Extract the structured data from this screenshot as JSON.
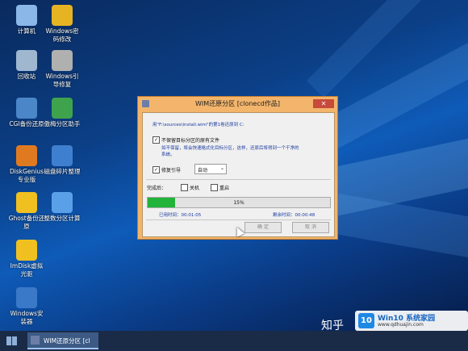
{
  "desktop_icons": [
    {
      "label": "计算机",
      "icon": "computer-icon",
      "color": "#8ab6e8"
    },
    {
      "label": "Windows密\n码修改",
      "icon": "key-icon",
      "color": "#e6b422"
    },
    {
      "label": "回收站",
      "icon": "recycle-bin-icon",
      "color": "#9fb7cf"
    },
    {
      "label": "Windows引\n导修复",
      "icon": "gear-icon",
      "color": "#b0b0b0"
    },
    {
      "label": "CGI备份还原",
      "icon": "cgi-icon",
      "color": "#4a86c8"
    },
    {
      "label": "傲梅分区助手",
      "icon": "partition-assistant-icon",
      "color": "#3fa34d"
    },
    {
      "label": "DiskGenius\n专业版",
      "icon": "diskgenius-icon",
      "color": "#e07a20"
    },
    {
      "label": "磁盘碎片整理",
      "icon": "defrag-icon",
      "color": "#3f7fd0"
    },
    {
      "label": "Ghost备份还\n原",
      "icon": "ghost-icon",
      "color": "#f0c020"
    },
    {
      "label": "整数分区计算",
      "icon": "partition-calc-icon",
      "color": "#5aa0e8"
    },
    {
      "label": "ImDisk虚拟\n光驱",
      "icon": "cd-icon",
      "color": "#f0c020"
    },
    {
      "label": "Windows安\n装器",
      "icon": "installer-icon",
      "color": "#3a78c8"
    }
  ],
  "dialog": {
    "title": "WIM还原分区 [clonecd作品]",
    "close": "✕",
    "info": "用\"F:\\sources\\install.wim\"的第1卷还原到 C:",
    "keep_label": "不保留目标分区的原有文件",
    "keep_desc1": "如不保留，将会快速格式化目标分区，这样，还原后将得到一个干净的",
    "keep_desc2": "系统。",
    "keep_checked": "✓",
    "boot_label": "修复引导",
    "boot_checked": "✓",
    "boot_select": "自动",
    "after_label": "完成后：",
    "shutdown_label": "关机",
    "restart_label": "重启",
    "progress_percent": 15,
    "progress_text": "15%",
    "elapsed": "已用时间：00:01:05",
    "remaining": "剩余时间：00:00:48",
    "ok": "确 定",
    "cancel": "取 消"
  },
  "taskbar": {
    "task_label": "WIM还原分区 [cl"
  },
  "watermark": {
    "left": "知乎",
    "brand": "Win10 系统家园",
    "url": "www.qdhuajin.com"
  }
}
